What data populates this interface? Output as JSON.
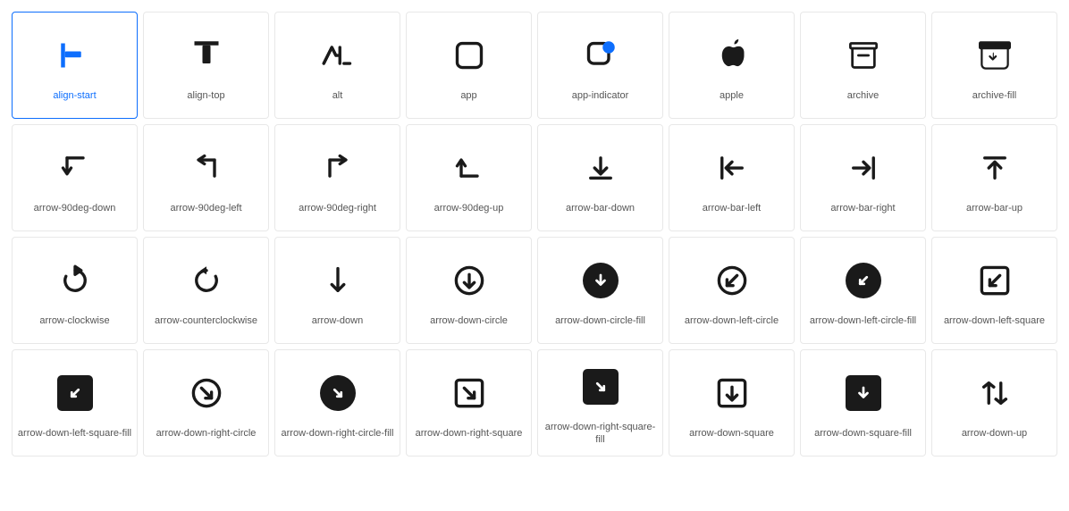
{
  "icons": [
    {
      "id": "align-start",
      "label": "align-start",
      "selected": true
    },
    {
      "id": "align-top",
      "label": "align-top",
      "selected": false
    },
    {
      "id": "alt",
      "label": "alt",
      "selected": false
    },
    {
      "id": "app",
      "label": "app",
      "selected": false
    },
    {
      "id": "app-indicator",
      "label": "app-indicator",
      "selected": false
    },
    {
      "id": "apple",
      "label": "apple",
      "selected": false
    },
    {
      "id": "archive",
      "label": "archive",
      "selected": false
    },
    {
      "id": "archive-fill",
      "label": "archive-fill",
      "selected": false
    },
    {
      "id": "arrow-90deg-down",
      "label": "arrow-90deg-down",
      "selected": false
    },
    {
      "id": "arrow-90deg-left",
      "label": "arrow-90deg-left",
      "selected": false
    },
    {
      "id": "arrow-90deg-right",
      "label": "arrow-90deg-right",
      "selected": false
    },
    {
      "id": "arrow-90deg-up",
      "label": "arrow-90deg-up",
      "selected": false
    },
    {
      "id": "arrow-bar-down",
      "label": "arrow-bar-down",
      "selected": false
    },
    {
      "id": "arrow-bar-left",
      "label": "arrow-bar-left",
      "selected": false
    },
    {
      "id": "arrow-bar-right",
      "label": "arrow-bar-right",
      "selected": false
    },
    {
      "id": "arrow-bar-up",
      "label": "arrow-bar-up",
      "selected": false
    },
    {
      "id": "arrow-clockwise",
      "label": "arrow-clockwise",
      "selected": false
    },
    {
      "id": "arrow-counterclockwise",
      "label": "arrow-counterclockwise",
      "selected": false
    },
    {
      "id": "arrow-down",
      "label": "arrow-down",
      "selected": false
    },
    {
      "id": "arrow-down-circle",
      "label": "arrow-down-circle",
      "selected": false
    },
    {
      "id": "arrow-down-circle-fill",
      "label": "arrow-down-circle-fill",
      "selected": false
    },
    {
      "id": "arrow-down-left-circle",
      "label": "arrow-down-left-circle",
      "selected": false
    },
    {
      "id": "arrow-down-left-circle-fill",
      "label": "arrow-down-left-circle-fill",
      "selected": false
    },
    {
      "id": "arrow-down-left-square",
      "label": "arrow-down-left-square",
      "selected": false
    },
    {
      "id": "arrow-down-left-square-fill",
      "label": "arrow-down-left-square-fill",
      "selected": false
    },
    {
      "id": "arrow-down-right-circle",
      "label": "arrow-down-right-circle",
      "selected": false
    },
    {
      "id": "arrow-down-right-circle-fill",
      "label": "arrow-down-right-circle-fill",
      "selected": false
    },
    {
      "id": "arrow-down-right-square",
      "label": "arrow-down-right-square",
      "selected": false
    },
    {
      "id": "arrow-down-right-square-fill",
      "label": "arrow-down-right-square-fill",
      "selected": false
    },
    {
      "id": "arrow-down-square",
      "label": "arrow-down-square",
      "selected": false
    },
    {
      "id": "arrow-down-square-fill",
      "label": "arrow-down-square-fill",
      "selected": false
    },
    {
      "id": "arrow-down-up",
      "label": "arrow-down-up",
      "selected": false
    }
  ]
}
